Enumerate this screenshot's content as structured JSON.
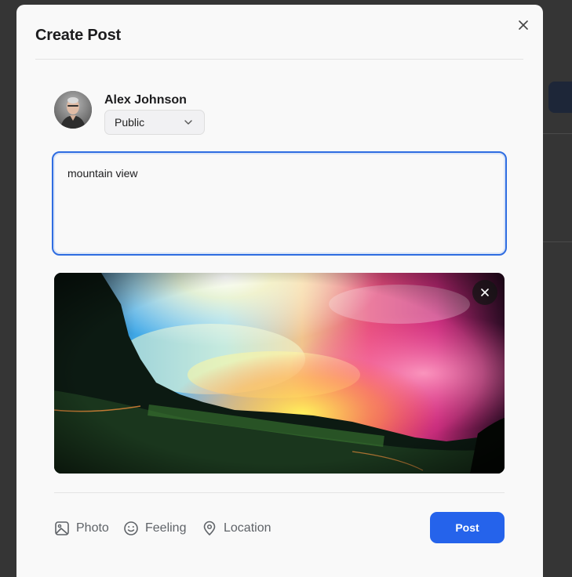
{
  "modal": {
    "title": "Create Post",
    "close_icon": "close-icon"
  },
  "author": {
    "name": "Alex Johnson",
    "privacy": "Public",
    "privacy_icon": "chevron-down-icon"
  },
  "composer": {
    "text": "mountain view"
  },
  "attachment": {
    "remove_icon": "close-icon"
  },
  "actions": [
    {
      "label": "Photo",
      "icon": "image-icon"
    },
    {
      "label": "Feeling",
      "icon": "smile-icon"
    },
    {
      "label": "Location",
      "icon": "map-pin-icon"
    }
  ],
  "submit": {
    "label": "Post",
    "color": "#2563eb"
  },
  "colors": {
    "focus_border": "#2f6de1",
    "muted_text": "#5f6368"
  }
}
